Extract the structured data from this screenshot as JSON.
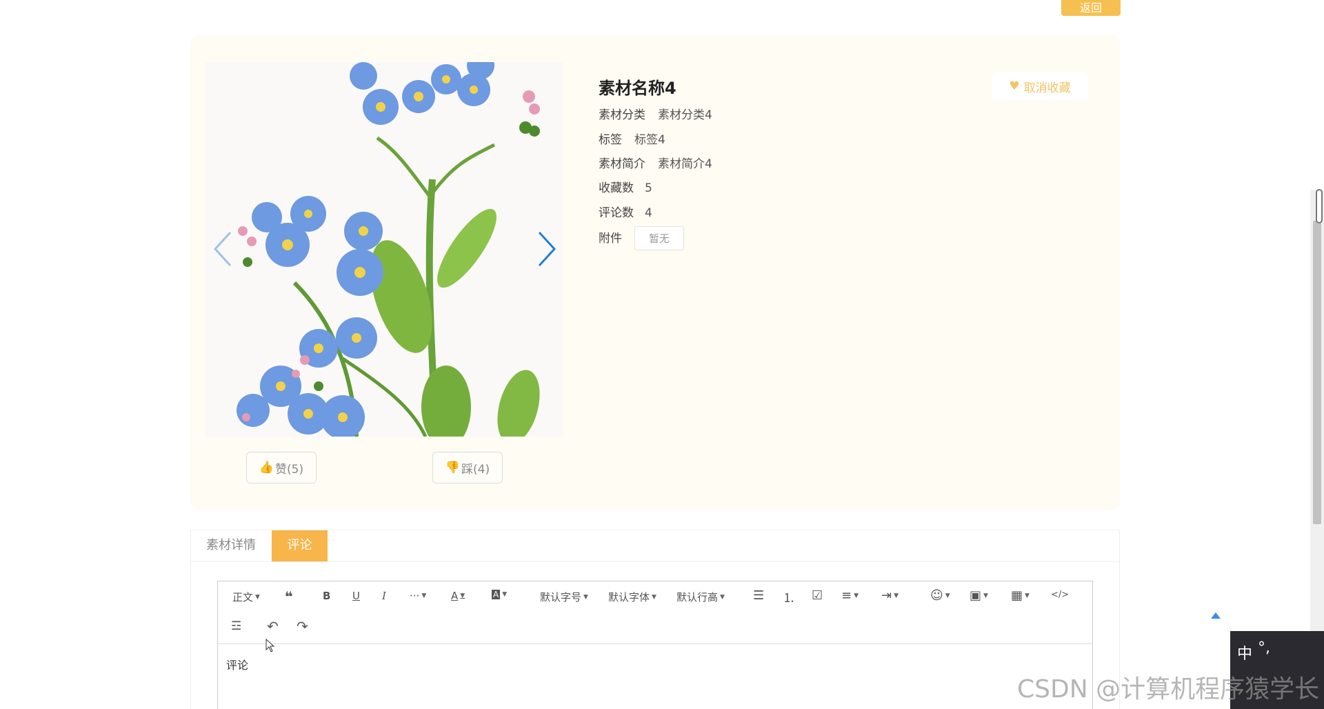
{
  "header": {
    "back_label": "返回"
  },
  "material": {
    "title": "素材名称4",
    "rows": [
      {
        "label": "素材分类",
        "value": "素材分类4"
      },
      {
        "label": "标签",
        "value": "标签4"
      },
      {
        "label": "素材简介",
        "value": "素材简介4"
      },
      {
        "label": "收藏数",
        "value": "5"
      },
      {
        "label": "评论数",
        "value": "4"
      }
    ],
    "attachment": {
      "label": "附件",
      "value": "暂无"
    },
    "favorite_label": "取消收藏"
  },
  "votes": {
    "like_label": "赞(5)",
    "dislike_label": "踩(4)"
  },
  "tabs": [
    {
      "label": "素材详情",
      "active": false
    },
    {
      "label": "评论",
      "active": true
    }
  ],
  "editor": {
    "toolbar": {
      "paragraph": "正文",
      "font_size": "默认字号",
      "font_family": "默认字体",
      "line_height": "默认行高"
    },
    "content": "评论"
  },
  "ime": {
    "mode": "中",
    "punct": "°,"
  },
  "watermark": "CSDN @计算机程序猿学长",
  "colors": {
    "accent": "#f8b54a",
    "card_bg": "#fffcf3",
    "arrow": "#1f7fd4"
  }
}
